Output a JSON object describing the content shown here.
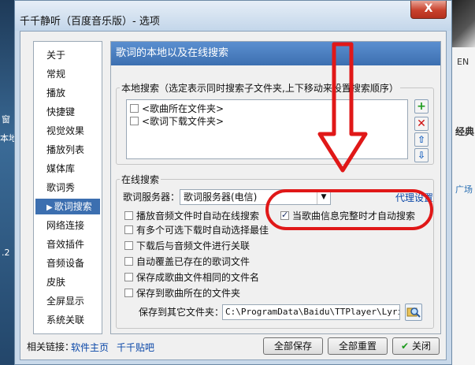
{
  "background": {
    "left_labels": [
      "窗",
      "本地",
      ".2"
    ],
    "right_labels": [
      "EN",
      "经典",
      "广场"
    ]
  },
  "window": {
    "title": "千千静听（百度音乐版）- 选项",
    "close_label": "X"
  },
  "nav": {
    "items": [
      "关于",
      "常规",
      "播放",
      "快捷键",
      "视觉效果",
      "播放列表",
      "媒体库",
      "歌词秀",
      "歌词搜索",
      "网络连接",
      "音效插件",
      "音频设备",
      "皮肤",
      "全屏显示",
      "系统关联"
    ],
    "selected_index": 8
  },
  "panel": {
    "header": "歌词的本地以及在线搜索",
    "local_search": {
      "legend": "本地搜索（选定表示同时搜索子文件夹,上下移动来设置搜索顺序）",
      "folders": [
        {
          "label": "<歌曲所在文件夹>",
          "checked": false
        },
        {
          "label": "<歌词下载文件夹>",
          "checked": false
        }
      ]
    },
    "online_search": {
      "legend": "在线搜索",
      "server_label": "歌词服务器：",
      "server_value": "歌词服务器(电信)",
      "proxy_link": "代理设置",
      "options": [
        {
          "label": "播放音频文件时自动在线搜索",
          "checked": false
        },
        {
          "label": "有多个可选下载时自动选择最佳",
          "checked": false
        },
        {
          "label": "下载后与音频文件进行关联",
          "checked": false
        },
        {
          "label": "自动覆盖已存在的歌词文件",
          "checked": false
        },
        {
          "label": "保存成歌曲文件相同的文件名",
          "checked": false
        },
        {
          "label": "保存到歌曲所在的文件夹",
          "checked": false
        }
      ],
      "complete_info_option": {
        "label": "当歌曲信息完整时才自动搜索",
        "checked": true
      },
      "save_other_label": "保存到其它文件夹：",
      "save_other_path": "C:\\ProgramData\\Baidu\\TTPlayer\\Lyrics\\"
    }
  },
  "footer": {
    "related_label": "相关链接：",
    "link1": "软件主页",
    "link2": "千千贴吧",
    "save_all": "全部保存",
    "reset_all": "全部重置",
    "close": "关闭"
  },
  "colors": {
    "accent": "#3c6fb0",
    "annotation_red": "#e01818"
  }
}
